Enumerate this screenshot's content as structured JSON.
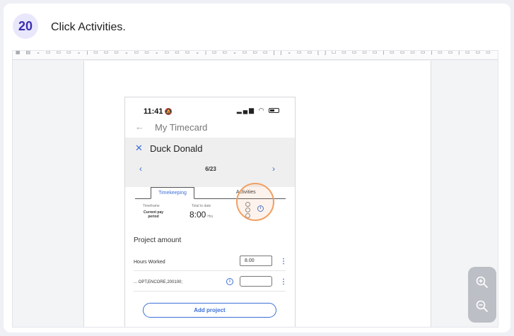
{
  "step": {
    "number": "20",
    "instruction": "Click Activities."
  },
  "phone": {
    "status_time": "11:41",
    "screen_title": "My Timecard",
    "modal": {
      "person_name": "Duck Donald",
      "date": "6/23",
      "tabs": [
        {
          "label": "Timekeeping",
          "active": true
        },
        {
          "label": "Activities",
          "active": false
        }
      ],
      "timeframe_label": "Timeframe",
      "timeframe_value": "Current pay period",
      "total_label": "Total to date",
      "total_value": "8:00",
      "total_unit": "Hrs",
      "project_amount_title": "Project amount",
      "hours_worked_label": "Hours Worked",
      "hours_worked_value": "8.00",
      "project_code": "... OPT,ENCORE,200100;",
      "add_project_label": "Add project"
    }
  },
  "colors": {
    "accent_blue": "#3b6fd6",
    "highlight_orange": "#f0a064",
    "badge_bg": "#e9e7fb",
    "badge_text": "#3c2fb0"
  },
  "icons": [
    "bell-mute-icon",
    "signal-icon",
    "wifi-icon",
    "battery-icon",
    "back-arrow-icon",
    "close-icon",
    "chevron-left-icon",
    "chevron-right-icon",
    "info-icon",
    "kebab-menu-icon",
    "zoom-in-icon",
    "zoom-out-icon"
  ]
}
